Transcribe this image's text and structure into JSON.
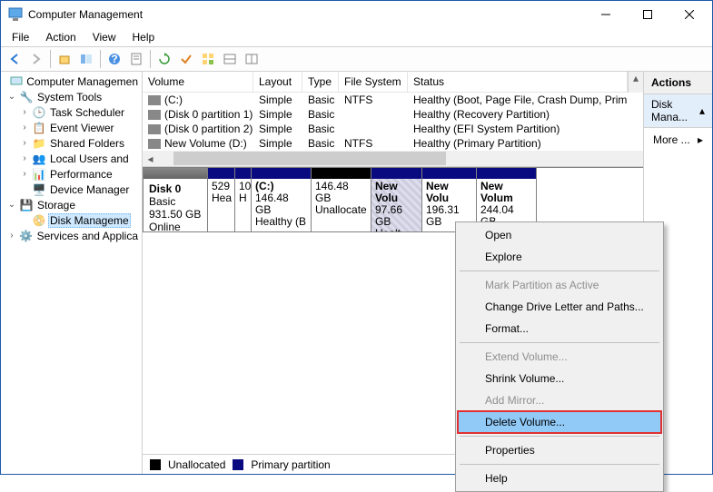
{
  "title": "Computer Management",
  "menubar": [
    "File",
    "Action",
    "View",
    "Help"
  ],
  "tree": {
    "root": "Computer Managemen",
    "system_tools": "System Tools",
    "task_scheduler": "Task Scheduler",
    "event_viewer": "Event Viewer",
    "shared_folders": "Shared Folders",
    "local_users": "Local Users and",
    "performance": "Performance",
    "device_manager": "Device Manager",
    "storage": "Storage",
    "disk_management": "Disk Manageme",
    "services": "Services and Applica"
  },
  "columns": {
    "volume": "Volume",
    "layout": "Layout",
    "type": "Type",
    "fs": "File System",
    "status": "Status"
  },
  "volumes": [
    {
      "name": "(C:)",
      "layout": "Simple",
      "type": "Basic",
      "fs": "NTFS",
      "status": "Healthy (Boot, Page File, Crash Dump, Prim"
    },
    {
      "name": "(Disk 0 partition 1)",
      "layout": "Simple",
      "type": "Basic",
      "fs": "",
      "status": "Healthy (Recovery Partition)"
    },
    {
      "name": "(Disk 0 partition 2)",
      "layout": "Simple",
      "type": "Basic",
      "fs": "",
      "status": "Healthy (EFI System Partition)"
    },
    {
      "name": "New Volume (D:)",
      "layout": "Simple",
      "type": "Basic",
      "fs": "NTFS",
      "status": "Healthy (Primary Partition)"
    }
  ],
  "disk": {
    "name": "Disk 0",
    "type": "Basic",
    "size": "931.50 GB",
    "state": "Online"
  },
  "parts": [
    {
      "title": "",
      "l1": "529",
      "l2": "Hea"
    },
    {
      "title": "",
      "l1": "10",
      "l2": "H"
    },
    {
      "title": "(C:)",
      "l1": "146.48 GB",
      "l2": "Healthy (B"
    },
    {
      "title": "",
      "l1": "146.48 GB",
      "l2": "Unallocate"
    },
    {
      "title": "New Volu",
      "l1": "97.66 GB",
      "l2": "Healt"
    },
    {
      "title": "New Volu",
      "l1": "196.31 GB",
      "l2": ""
    },
    {
      "title": "New Volum",
      "l1": "244.04 GB",
      "l2": ""
    }
  ],
  "legend": {
    "unalloc": "Unallocated",
    "primary": "Primary partition"
  },
  "actions": {
    "header": "Actions",
    "group": "Disk Mana...",
    "more": "More ..."
  },
  "ctx": {
    "open": "Open",
    "explore": "Explore",
    "mark": "Mark Partition as Active",
    "change": "Change Drive Letter and Paths...",
    "format": "Format...",
    "extend": "Extend Volume...",
    "shrink": "Shrink Volume...",
    "mirror": "Add Mirror...",
    "delete": "Delete Volume...",
    "props": "Properties",
    "help": "Help"
  }
}
